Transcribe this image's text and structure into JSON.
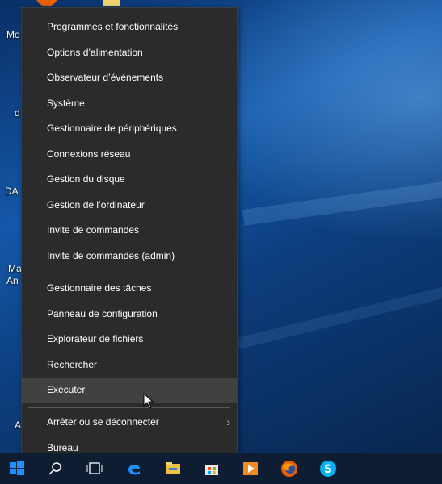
{
  "desktop": {
    "labels": [
      "Mo",
      "d",
      "DA",
      "Ma",
      "An",
      "A"
    ]
  },
  "menu": {
    "group1": [
      {
        "label": "Programmes et fonctionnalités"
      },
      {
        "label": "Options d’alimentation"
      },
      {
        "label": "Observateur d’événements"
      },
      {
        "label": "Système"
      },
      {
        "label": "Gestionnaire de périphériques"
      },
      {
        "label": "Connexions réseau"
      },
      {
        "label": "Gestion du disque"
      },
      {
        "label": "Gestion de l’ordinateur"
      },
      {
        "label": "Invite de commandes"
      },
      {
        "label": "Invite de commandes (admin)"
      }
    ],
    "group2": [
      {
        "label": "Gestionnaire des tâches"
      },
      {
        "label": "Panneau de configuration"
      },
      {
        "label": "Explorateur de fichiers"
      },
      {
        "label": "Rechercher"
      },
      {
        "label": "Exécuter"
      }
    ],
    "group3": [
      {
        "label": "Arrêter ou se déconnecter",
        "submenu_arrow": "›"
      },
      {
        "label": "Bureau"
      }
    ],
    "hovered_item": "Exécuter"
  },
  "taskbar": {
    "icons": [
      "windows-start-icon",
      "search-icon",
      "task-view-icon",
      "edge-icon",
      "file-explorer-icon",
      "store-icon",
      "media-player-icon",
      "firefox-icon",
      "skype-icon"
    ],
    "colors": {
      "background": "#0f1d33",
      "accent": "#1e90ff"
    }
  }
}
